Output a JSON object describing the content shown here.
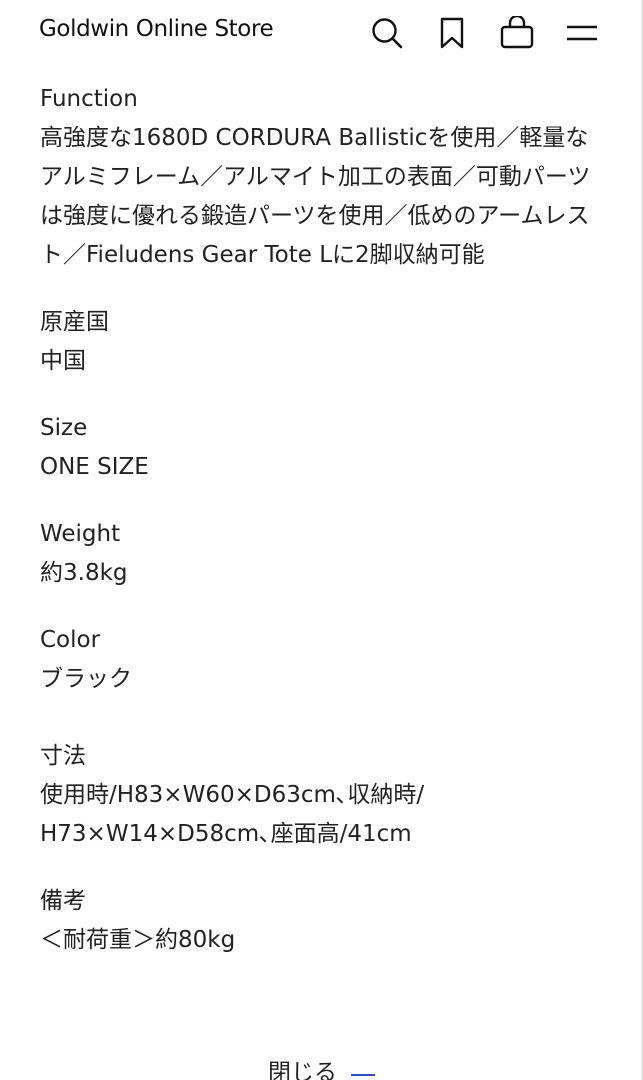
{
  "header": {
    "brand": "Goldwin Online Store",
    "icons": [
      "search-icon",
      "bookmark-icon",
      "cart-icon",
      "menu-icon"
    ]
  },
  "specs": {
    "function": {
      "label": "Function",
      "value": "高強度な1680D CORDURA Ballisticを使用／軽量なアルミフレーム／アルマイト加工の表面／可動パーツは強度に優れる鍛造パーツを使用／低めのアームレスト／Fieludens Gear Tote Lに2脚収納可能"
    },
    "origin": {
      "label": "原産国",
      "value": "中国"
    },
    "size": {
      "label": "Size",
      "value": "ONE SIZE"
    },
    "weight": {
      "label": "Weight",
      "value": "約3.8kg"
    },
    "color": {
      "label": "Color",
      "value": "ブラック"
    },
    "dimensions": {
      "label": "寸法",
      "line1": "使用時/H83×W60×D63cm､収納時/",
      "line2": "H73×W14×D58cm､座面高/41cm"
    },
    "notes": {
      "label": "備考",
      "value": "＜耐荷重＞約80kg"
    }
  },
  "footer": {
    "close_label": "閉じる"
  },
  "colors": {
    "text": "#222222",
    "accent": "#2a4bd8",
    "background": "#ffffff"
  }
}
